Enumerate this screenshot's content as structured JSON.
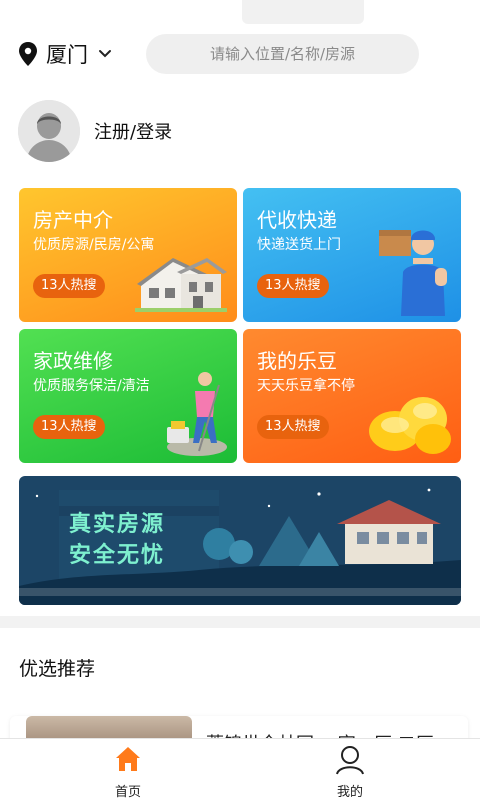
{
  "header": {
    "city": "厦门",
    "search_placeholder": "请输入位置/名称/房源"
  },
  "profile": {
    "login_label": "注册/登录"
  },
  "services": [
    {
      "title": "房产中介",
      "subtitle": "优质房源/民房/公寓",
      "badge": "13人热搜",
      "icon": "house-illustration-icon"
    },
    {
      "title": "代收快递",
      "subtitle": "快递送货上门",
      "badge": "13人热搜",
      "icon": "courier-illustration-icon"
    },
    {
      "title": "家政维修",
      "subtitle": "优质服务保洁/清洁",
      "badge": "13人热搜",
      "icon": "cleaning-illustration-icon"
    },
    {
      "title": "我的乐豆",
      "subtitle": "天天乐豆拿不停",
      "badge": "13人热搜",
      "icon": "coins-illustration-icon"
    }
  ],
  "banner": {
    "line1": "真实房源",
    "line2": "安全无忧"
  },
  "recommend": {
    "heading": "优选推荐",
    "first_item_title": "蔷锦世全林园 一室一厅 二厅"
  },
  "tabbar": {
    "home_label": "首页",
    "me_label": "我的",
    "active": "home",
    "accent_color": "#ff7a1a"
  }
}
